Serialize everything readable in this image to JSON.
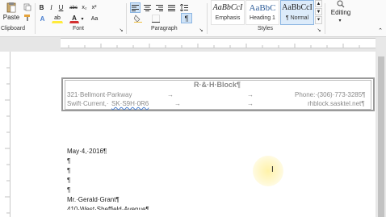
{
  "ribbon": {
    "paste_label": "Paste",
    "groups": {
      "clipboard": "Clipboard",
      "font": "Font",
      "paragraph": "Paragraph",
      "styles": "Styles"
    },
    "font_buttons": {
      "bold": "B",
      "italic": "I",
      "underline": "U",
      "strikethrough": "abc",
      "subscript": "x₂",
      "superscript": "x²",
      "text_effects": "A",
      "highlight": "ab",
      "font_color": "A",
      "grow": "Aa"
    },
    "paragraph_buttons": {
      "pilcrow": "¶"
    },
    "styles": [
      {
        "sample": "AaBbCcI",
        "label": "Emphasis"
      },
      {
        "sample": "AaBbC",
        "label": "Heading 1"
      },
      {
        "sample": "AaBbCcI",
        "label": "¶ Normal"
      }
    ],
    "editing_label": "Editing"
  },
  "document": {
    "header": {
      "title": "R·&·H·Block¶",
      "address_line1": "321·Bellmont·Parkway",
      "phone": "Phone:·(306)·773-3285¶",
      "address_line2_city": "Swift·Current,·",
      "address_line2_code": "SK·S9H·0R6",
      "website": "rhblock.sasktel.net¶",
      "tab_arrow": "→"
    },
    "body_lines": [
      "May·4,·2016¶",
      "¶",
      "¶",
      "¶",
      "¶",
      "Mr.·Gerald·Grant¶",
      "410·West·Sheffield·Avenue¶"
    ],
    "cursor_glyph": "I"
  }
}
